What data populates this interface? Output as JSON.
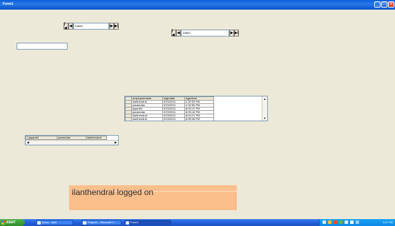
{
  "window": {
    "title": "Form1",
    "min_glyph": "_",
    "max_glyph": "□",
    "close_glyph": "x"
  },
  "nav_top_left": {
    "first": "|◀",
    "prev": "◀",
    "value": "Data2",
    "next": "▶",
    "last": "▶|"
  },
  "nav_top_right": {
    "first": "|◀",
    "prev": "◀",
    "value": "Data1",
    "next": "▶",
    "last": "▶|"
  },
  "main_grid": {
    "columns": [
      "employeename",
      "logindate",
      "logintime"
    ],
    "rows": [
      [
        "ilanthendral",
        "9/23/2011",
        "2:32:53 PM"
      ],
      [
        "paramdas",
        "9/23/2011",
        "2:32:55 PM"
      ],
      [
        "jayanthi",
        "9/23/2011",
        "8:03:12 PM"
      ],
      [
        "paramdas",
        "9/23/2011",
        "8:03:18 PM"
      ],
      [
        "ilanthendral",
        "9/23/2011",
        "8:03:21 PM"
      ],
      [
        "ilanthendral",
        "9/23/2011",
        "8:05:48 PM"
      ]
    ]
  },
  "small_grid": {
    "columns": [
      "jayanthi",
      "paramdas",
      "ilanthendral"
    ]
  },
  "status": {
    "message": "ilanthendral logged on"
  },
  "taskbar": {
    "start_label": "start",
    "tasks": [
      "Inbox - Mail",
      "Project1 - Microsoft V...",
      "Form1"
    ],
    "clock": "2:07 PM"
  },
  "colors": {
    "titlebar": "#0a5fdc",
    "status_panel": "#fbbf8c",
    "taskbar": "#245edc",
    "start": "#3c9a37"
  }
}
